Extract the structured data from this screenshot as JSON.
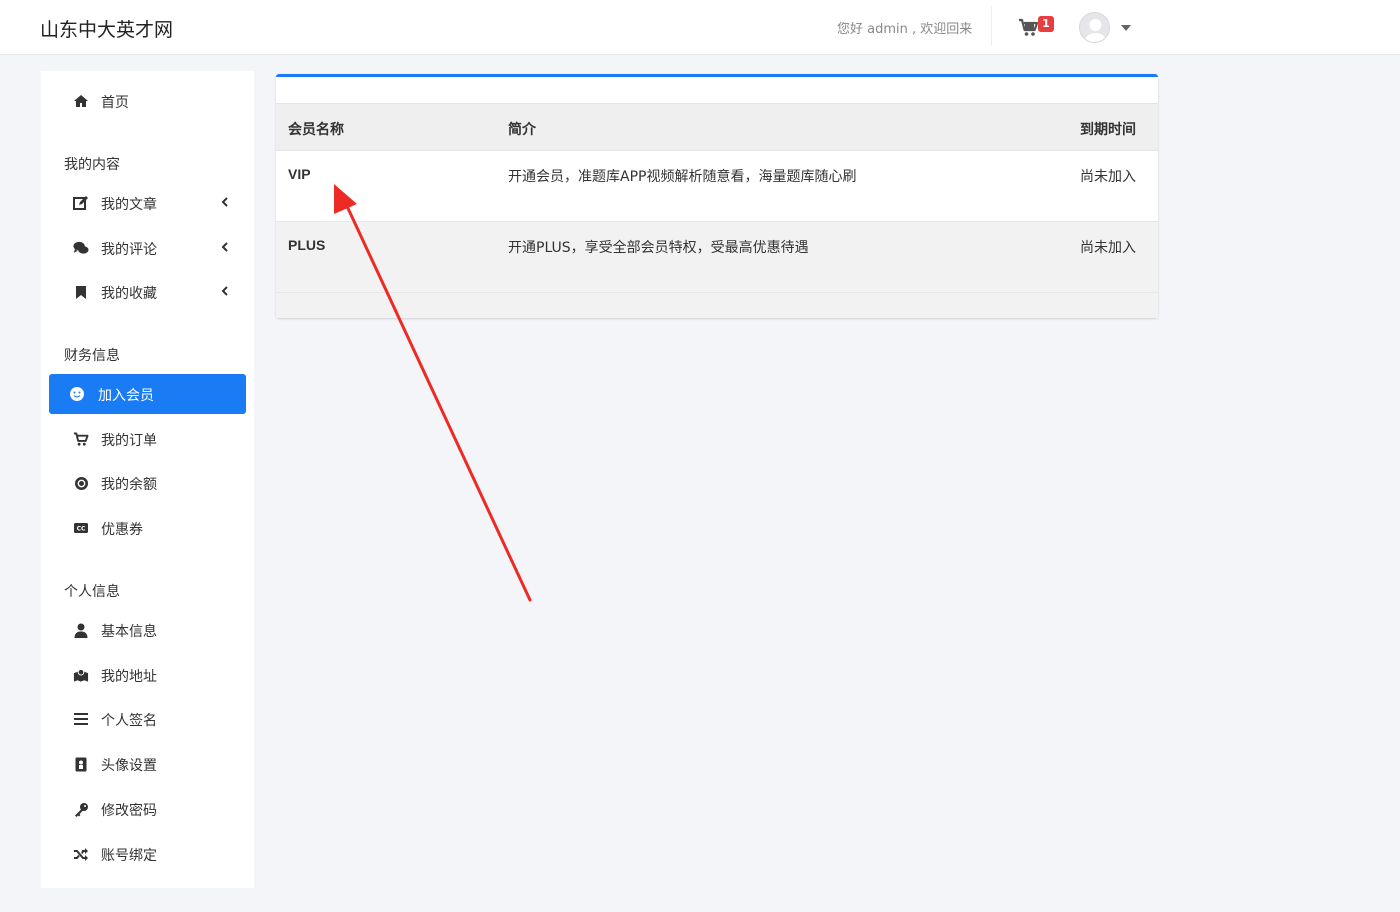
{
  "header": {
    "brand": "山东中大英才网",
    "greeting": "您好 admin , 欢迎回来",
    "cart_count": "1"
  },
  "sidebar": {
    "home": "首页",
    "section_content": "我的内容",
    "articles": "我的文章",
    "comments": "我的评论",
    "favorites": "我的收藏",
    "section_finance": "财务信息",
    "join_member": "加入会员",
    "orders": "我的订单",
    "balance": "我的余额",
    "coupons": "优惠券",
    "section_personal": "个人信息",
    "basic_info": "基本信息",
    "address": "我的地址",
    "signature": "个人签名",
    "avatar_settings": "头像设置",
    "change_password": "修改密码",
    "account_binding": "账号绑定"
  },
  "table": {
    "headers": [
      "会员名称",
      "简介",
      "到期时间"
    ],
    "rows": [
      {
        "name": "VIP",
        "desc": "开通会员，准题库APP视频解析随意看，海量题库随心刷",
        "expire": "尚未加入"
      },
      {
        "name": "PLUS",
        "desc": "开通PLUS，享受全部会员特权，受最高优惠待遇",
        "expire": "尚未加入"
      }
    ]
  },
  "colors": {
    "accent": "#1a7cf5",
    "badge": "#e63e3e",
    "annotation_arrow": "#ee2a24"
  }
}
